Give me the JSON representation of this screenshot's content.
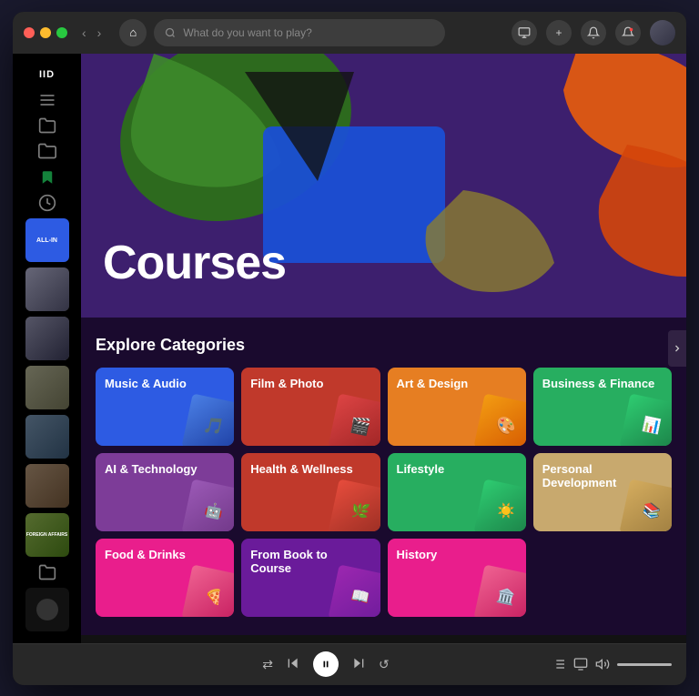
{
  "window": {
    "title": "Courses"
  },
  "titlebar": {
    "back_label": "‹",
    "forward_label": "›",
    "home_icon": "⌂",
    "search_placeholder": "What do you want to play?",
    "add_icon": "+",
    "notification_icon": "🔔",
    "settings_icon": "⚙"
  },
  "hero": {
    "title": "Courses"
  },
  "section": {
    "explore_label": "Explore Categories"
  },
  "categories": [
    {
      "id": "music-audio",
      "label": "Music & Audio",
      "color": "#2d5be3",
      "image_color": "#4a90d9"
    },
    {
      "id": "film-photo",
      "label": "Film & Photo",
      "color": "#c0392b",
      "image_color": "#922b21"
    },
    {
      "id": "art-design",
      "label": "Art & Design",
      "color": "#e67e22",
      "image_color": "#d35400"
    },
    {
      "id": "business-finance",
      "label": "Business & Finance",
      "color": "#27ae60",
      "image_color": "#1e8449"
    },
    {
      "id": "ai-technology",
      "label": "AI & Technology",
      "color": "#8e44ad",
      "image_color": "#6c3483"
    },
    {
      "id": "health-wellness",
      "label": "Health & Wellness",
      "color": "#c0392b",
      "image_color": "#922b21"
    },
    {
      "id": "lifestyle",
      "label": "Lifestyle",
      "color": "#27ae60",
      "image_color": "#1e8449"
    },
    {
      "id": "personal-development",
      "label": "Personal Development",
      "color": "#c8a96e",
      "image_color": "#b7950b"
    },
    {
      "id": "food-drinks",
      "label": "Food & Drinks",
      "color": "#e91e8c",
      "image_color": "#c2185b"
    },
    {
      "id": "from-book-course",
      "label": "From Book to Course",
      "color": "#9c27b0",
      "image_color": "#7b1fa2"
    },
    {
      "id": "history",
      "label": "History",
      "color": "#e91e8c",
      "image_color": "#c2185b"
    }
  ],
  "sidebar": {
    "top_label": "IID",
    "items": [
      {
        "id": "library",
        "icon": "≡"
      },
      {
        "id": "folder1",
        "icon": "📁"
      },
      {
        "id": "folder2",
        "icon": "📂"
      },
      {
        "id": "bookmark",
        "icon": "🔖"
      },
      {
        "id": "clock",
        "icon": "🕐"
      }
    ]
  },
  "player": {
    "shuffle_icon": "⇄",
    "prev_icon": "⏮",
    "play_icon": "⏸",
    "next_icon": "⏭",
    "repeat_icon": "↺",
    "volume_icon": "🔊"
  }
}
